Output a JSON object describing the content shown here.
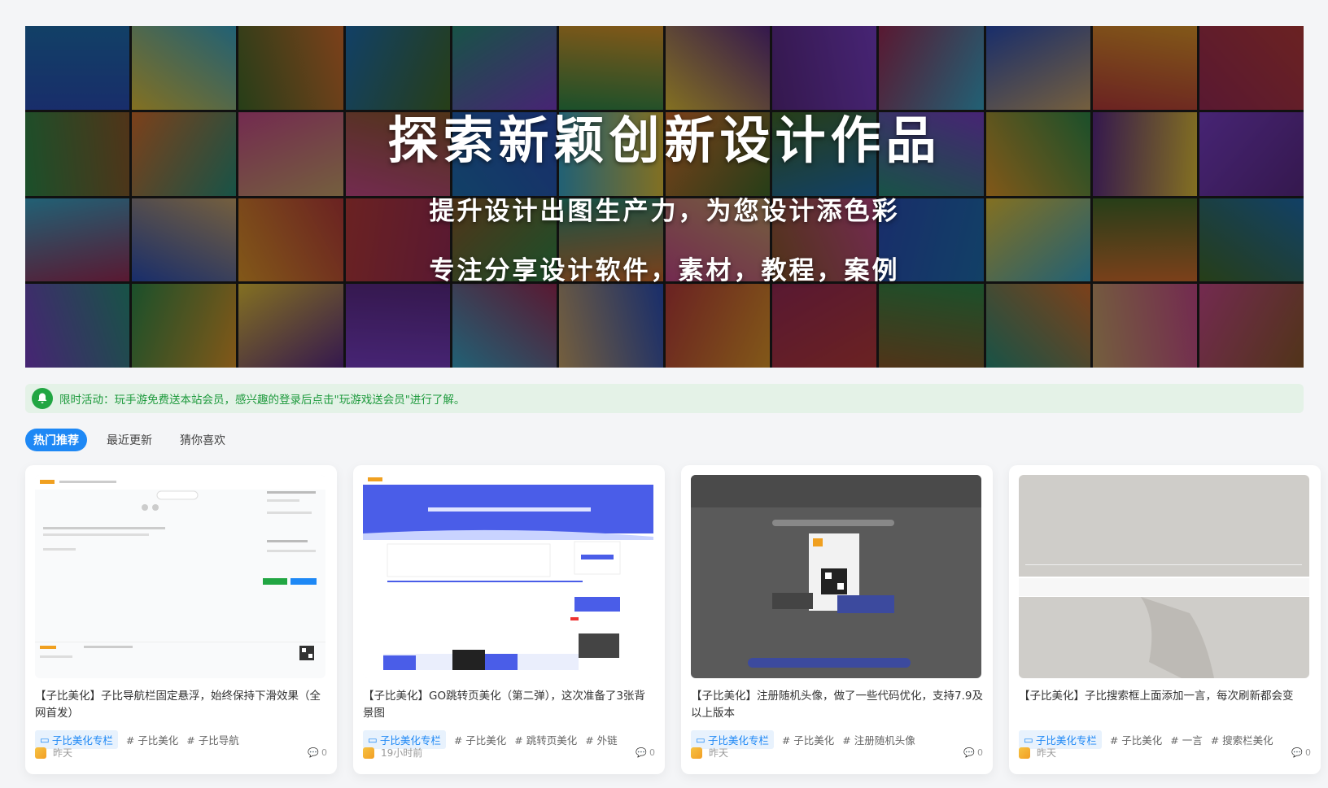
{
  "banner": {
    "title": "探索新颖创新设计作品",
    "subtitle": "提升设计出图生产力，为您设计添色彩",
    "subtitle2": "专注分享设计软件，素材，教程，案例"
  },
  "notice": {
    "text": "限时活动：玩手游免费送本站会员，感兴趣的登录后点击\"玩游戏送会员\"进行了解。"
  },
  "tabs": [
    {
      "label": "热门推荐",
      "active": true
    },
    {
      "label": "最近更新",
      "active": false
    },
    {
      "label": "猜你喜欢",
      "active": false
    }
  ],
  "cards": [
    {
      "title": "【子比美化】子比导航栏固定悬浮，始终保持下滑效果（全网首发）",
      "category": "子比美化专栏",
      "tags": [
        "# 子比美化",
        "# 子比导航"
      ],
      "time": "昨天",
      "comments": "0"
    },
    {
      "title": "【子比美化】GO跳转页美化（第二弹），这次准备了3张背景图",
      "category": "子比美化专栏",
      "tags": [
        "# 子比美化",
        "# 跳转页美化",
        "# 外链"
      ],
      "time": "19小时前",
      "comments": "0"
    },
    {
      "title": "【子比美化】注册随机头像，做了一些代码优化，支持7.9及以上版本",
      "category": "子比美化专栏",
      "tags": [
        "# 子比美化",
        "# 注册随机头像"
      ],
      "time": "昨天",
      "comments": "0"
    },
    {
      "title": "【子比美化】子比搜索框上面添加一言，每次刷新都会变",
      "category": "子比美化专栏",
      "tags": [
        "# 子比美化",
        "# 一言",
        "# 搜索栏美化"
      ],
      "time": "昨天",
      "comments": "0"
    }
  ],
  "colors": {
    "accent": "#1e88f5",
    "notice_bg": "#e4f2e7",
    "notice_text": "#1d9a3c"
  }
}
